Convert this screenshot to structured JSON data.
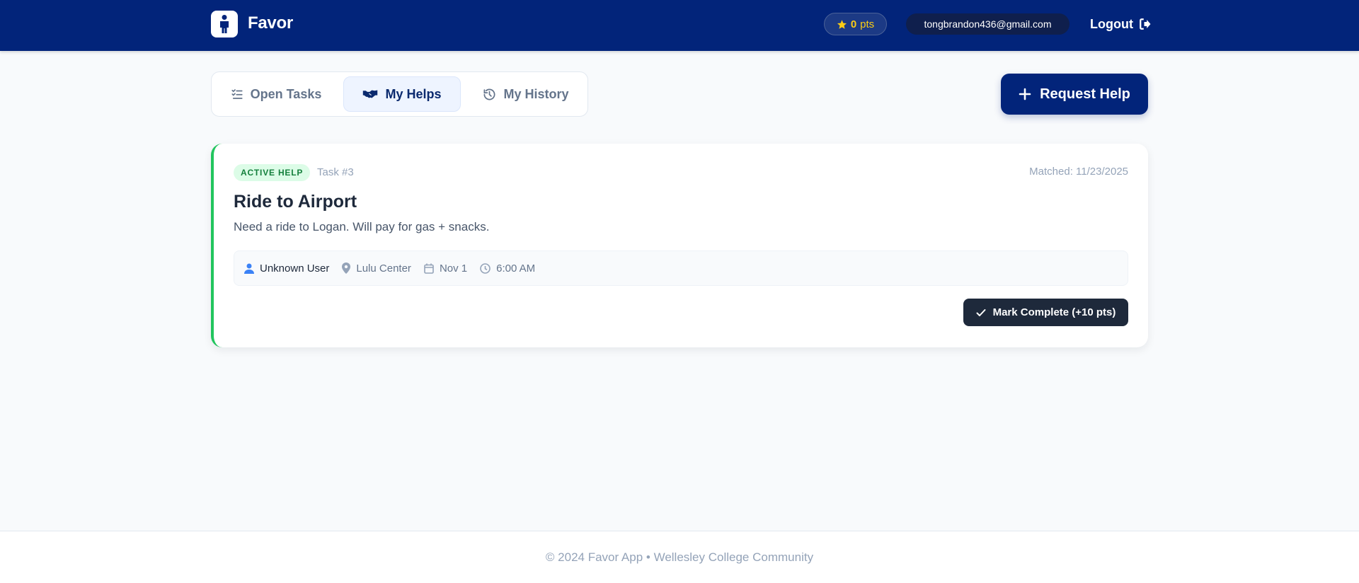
{
  "header": {
    "brand": "Favor",
    "points_value": "0",
    "points_unit": "pts",
    "email": "tongbrandon436@gmail.com",
    "logout_label": "Logout"
  },
  "tabs": [
    {
      "label": "Open Tasks",
      "icon": "checklist-icon",
      "active": false
    },
    {
      "label": "My Helps",
      "icon": "handshake-icon",
      "active": true
    },
    {
      "label": "My History",
      "icon": "history-icon",
      "active": false
    }
  ],
  "request_button": {
    "label": "Request Help"
  },
  "task_card": {
    "status_badge": "ACTIVE HELP",
    "task_id": "Task #3",
    "matched": "Matched: 11/23/2025",
    "title": "Ride to Airport",
    "description": "Need a ride to Logan. Will pay for gas + snacks.",
    "requester": "Unknown User",
    "location": "Lulu Center",
    "date": "Nov 1",
    "time": "6:00 AM",
    "complete_button": "Mark Complete (+10 pts)"
  },
  "footer": {
    "text": "© 2024 Favor App • Wellesley College Community"
  },
  "colors": {
    "header_bg": "#02247a",
    "accent_green": "#22c55e",
    "points_star": "#facc15",
    "dark_button": "#1e293b"
  }
}
